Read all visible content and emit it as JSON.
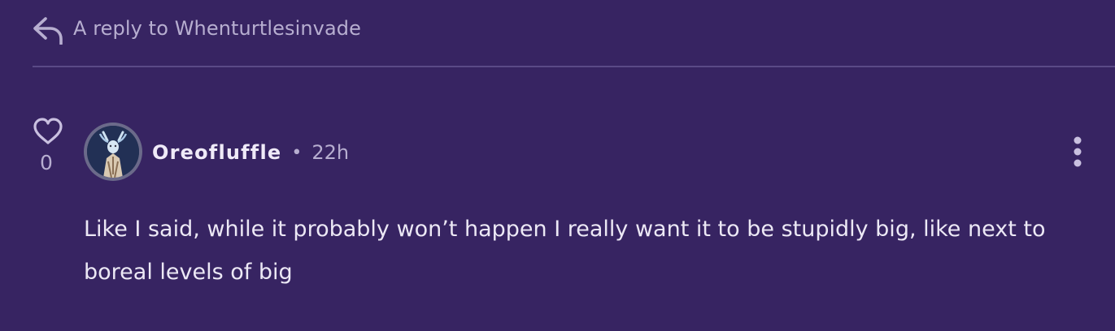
{
  "reply": {
    "icon": "reply-arrow-icon",
    "text": "A reply to Whenturtlesinvade"
  },
  "vote": {
    "icon": "heart-outline-icon",
    "count": "0"
  },
  "comment": {
    "avatar": "avatar",
    "author": "Oreofluffle",
    "separator": "•",
    "time": "22h",
    "more_icon": "more-vertical-icon",
    "body": "Like I said, while it probably won’t happen I really want it to be stupidly big, like next to boreal levels of big"
  },
  "colors": {
    "background": "#372462",
    "divider": "#5a4a86",
    "muted_text": "#b7aed0",
    "text": "#ece8f5"
  }
}
